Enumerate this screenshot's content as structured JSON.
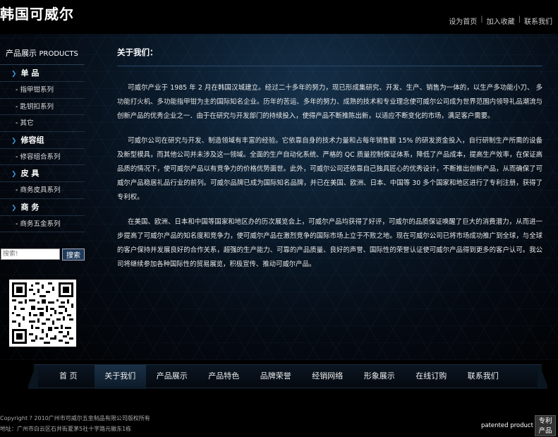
{
  "header": {
    "logo": "韩国可威尔",
    "links": [
      "设为首页",
      "加入收藏",
      "联系我们"
    ],
    "separator": "|"
  },
  "sidebar": {
    "title_cn": "产品展示",
    "title_en": "PRODUCTS",
    "categories": [
      {
        "label": "单 品",
        "items": [
          "指甲钳系列",
          "匙钥扣系列",
          "其它"
        ]
      },
      {
        "label": "修容组",
        "items": [
          "修容组合系列"
        ]
      },
      {
        "label": "皮 具",
        "items": [
          "商务皮具系列"
        ]
      },
      {
        "label": "商 务",
        "items": [
          "商务五金系列"
        ]
      }
    ],
    "search": {
      "placeholder": "搜索!",
      "button": "搜索"
    }
  },
  "content": {
    "title": "关于我们：",
    "paragraphs": [
      "可威尔产业于 1985 年 2 月在韩国汉城建立。经过二十多年的努力，现已形成集研究、开发、生产、销售为一体的，以生产多功能小刀、 多功能打火机、多功能指甲钳为主的国际知名企业。历年的苦运、多年的努力、成熟的技术和专业理念使可威尔公司成为世界范围内领导礼品潮流与创新产品的优秀企业之一．由于在研究与开发部门的持续投入，使得产品不断推陈出新，以适应不断变化的市场，满足客户需要。",
      "可威尔公司在研究与开发、制造领域有丰富的经验。它依靠自身的技术力量和占每年销售额 15% 的研发资金投入，自行研制生产所需的设备及新型模具，而其他公司并未涉及这一领域。全面的生产自动化系统、严格的 QC 质量控制保证体系，降低了产品成本，提高生产效率，在保证高品质的情况下，使可威尔产品以有竞争力的价格优势面世。此外，可威尔公司还依靠自己独具匠心的优秀设计，不断推出创新产品，从而确保了可威尔产品稳居礼品行业的前列。可威尔品牌已成为国际知名品牌，并已在美国、欧洲、日本、中国等 30 多个国家和地区进行了专利注册，获得了专利权。",
      "在美国、欧洲、日本和中国等国家和地区办的历次展览会上，可威尔产品均获得了好评，可威尔的品质保证唤醒了巨大的消费潜力，从而进一步提高了可威尔产品的知名度和竞争力，使可威尔产品在激烈竞争的国际市场上立于不败之地。现在可威尔公司已将市场成功推广到全球，与全球的客户保持并发展良好的合作关系，超强的生产能力、可靠的产品质量、良好的声誉、国际性的荣誉认证使可威尔产品得到更多的客户认可。我公司将继续参加各种国际性的贸易展览，积极宣传、推动可威尔产品。"
    ]
  },
  "nav": {
    "items": [
      "首 页",
      "关于我们",
      "产品展示",
      "产品特色",
      "品牌荣誉",
      "经销网络",
      "形象展示",
      "在线订购",
      "联系我们"
    ],
    "active_index": 1
  },
  "footer": {
    "copyright": "Copyright ? 2010广州市可威尔五金制品有限公司版权所有",
    "address": "地址：广州市白云区石井街夏茅5社十字路元徽东1栋",
    "patent_text": "patented product",
    "patent_button": "专利产品"
  }
}
